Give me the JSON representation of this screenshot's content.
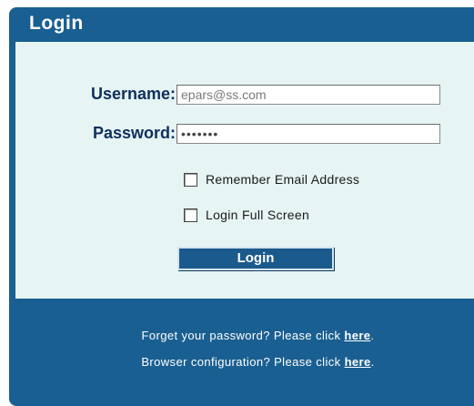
{
  "panel": {
    "title": "Login"
  },
  "form": {
    "username_label": "Username:",
    "username_value": "epars@ss.com",
    "password_label": "Password:",
    "password_value": "•••••••",
    "remember_label": "Remember Email Address",
    "remember_checked": false,
    "fullscreen_label": "Login Full Screen",
    "fullscreen_checked": false,
    "login_button": "Login"
  },
  "footer": {
    "forgot_text": "Forget your password? Please click ",
    "forgot_link": "here",
    "forgot_end": ".",
    "browser_text": "Browser configuration? Please click ",
    "browser_link": "here",
    "browser_end": "."
  },
  "colors": {
    "header_blue": "#1a5f91",
    "form_background": "#e6f4f4",
    "label_color": "#0f2f5c"
  }
}
